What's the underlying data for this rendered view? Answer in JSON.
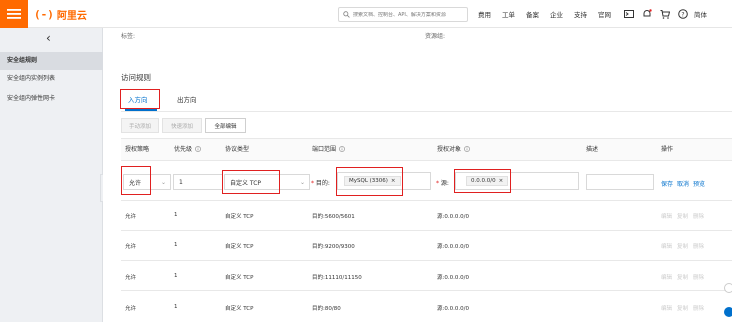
{
  "header": {
    "logo_mark": "(-)",
    "logo_text": "阿里云",
    "search_placeholder": "搜索文档、控制台、API、解决方案和资源",
    "nav": [
      "费用",
      "工单",
      "备案",
      "企业",
      "支持",
      "官网"
    ],
    "lang": "简体",
    "colors": {
      "brand": "#ff6a00"
    }
  },
  "sidebar": {
    "back_icon": "chevron-left-icon",
    "items": [
      {
        "label": "安全组规则",
        "active": true
      },
      {
        "label": "安全组内实例列表",
        "active": false
      },
      {
        "label": "安全组内弹性网卡",
        "active": false
      }
    ]
  },
  "main": {
    "tags_label": "标签:",
    "resgroup_label": "资源组:",
    "section_title": "访问规则",
    "tabs": [
      {
        "label": "入方向",
        "active": true
      },
      {
        "label": "出方向",
        "active": false
      }
    ],
    "buttons": {
      "manual_add": "手动添加",
      "quick_add": "快速添加",
      "bulk_edit": "全部编辑"
    },
    "columns": [
      "授权策略",
      "优先级",
      "协议类型",
      "端口范围",
      "授权对象",
      "描述",
      "操作"
    ],
    "edit_row": {
      "policy": "允许",
      "priority": "1",
      "protocol": "自定义 TCP",
      "dest_label": "目的:",
      "dest_tag": "MySQL (3306)",
      "src_label": "源:",
      "src_tag": "0.0.0.0/0",
      "actions": [
        "保存",
        "取消",
        "预览"
      ]
    },
    "rows": [
      {
        "policy": "允许",
        "priority": "1",
        "protocol": "自定义 TCP",
        "port": "目的:5600/5601",
        "source": "源:0.0.0.0/0"
      },
      {
        "policy": "允许",
        "priority": "1",
        "protocol": "自定义 TCP",
        "port": "目的:9200/9300",
        "source": "源:0.0.0.0/0"
      },
      {
        "policy": "允许",
        "priority": "1",
        "protocol": "自定义 TCP",
        "port": "目的:11110/11150",
        "source": "源:0.0.0.0/0"
      },
      {
        "policy": "允许",
        "priority": "1",
        "protocol": "自定义 TCP",
        "port": "目的:80/80",
        "source": "源:0.0.0.0/0"
      }
    ],
    "row_actions": [
      "编辑",
      "复制",
      "删除"
    ]
  }
}
